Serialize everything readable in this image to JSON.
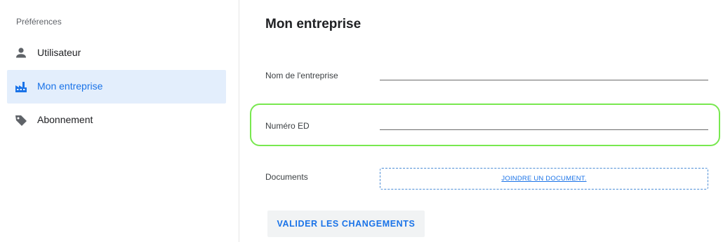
{
  "sidebar": {
    "title": "Préférences",
    "items": [
      {
        "label": "Utilisateur",
        "icon": "person-icon",
        "active": false
      },
      {
        "label": "Mon entreprise",
        "icon": "factory-icon",
        "active": true
      },
      {
        "label": "Abonnement",
        "icon": "tag-icon",
        "active": false
      }
    ]
  },
  "main": {
    "title": "Mon entreprise",
    "fields": {
      "company_name": {
        "label": "Nom de l'entreprise",
        "value": "",
        "placeholder": ""
      },
      "ed_number": {
        "label": "Numéro ED",
        "value": "",
        "placeholder": ""
      },
      "documents": {
        "label": "Documents",
        "action_label": "JOINDRE UN DOCUMENT."
      }
    },
    "submit_label": "VALIDER LES CHANGEMENTS"
  },
  "colors": {
    "accent": "#1a73e8",
    "active_bg": "#e3eefc",
    "highlight": "#78e84f",
    "icon_gray": "#5f6368"
  }
}
